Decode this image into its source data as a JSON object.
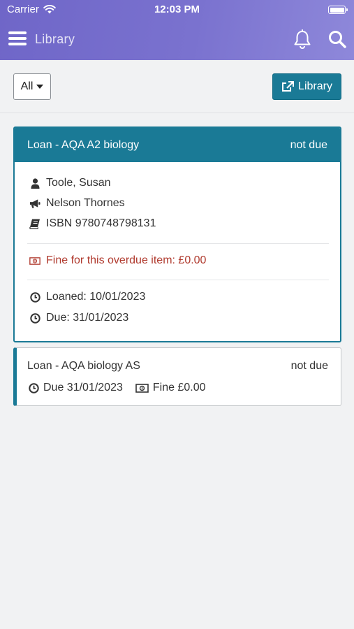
{
  "status_bar": {
    "carrier": "Carrier",
    "time": "12:03 PM"
  },
  "nav": {
    "title": "Library"
  },
  "toolbar": {
    "filter_value": "All",
    "library_button": "Library"
  },
  "loans": [
    {
      "title": "Loan - AQA A2 biology",
      "status": "not due",
      "author": "Toole, Susan",
      "publisher": "Nelson Thornes",
      "isbn": "ISBN 9780748798131",
      "fine": "Fine for this overdue item: £0.00",
      "loaned": "Loaned: 10/01/2023",
      "due": "Due: 31/01/2023"
    },
    {
      "title": "Loan - AQA biology AS",
      "status": "not due",
      "due": "Due 31/01/2023",
      "fine": "Fine £0.00"
    }
  ],
  "colors": {
    "header": "#7a72cf",
    "accent": "#1a7a96",
    "fine": "#b03a2e"
  }
}
